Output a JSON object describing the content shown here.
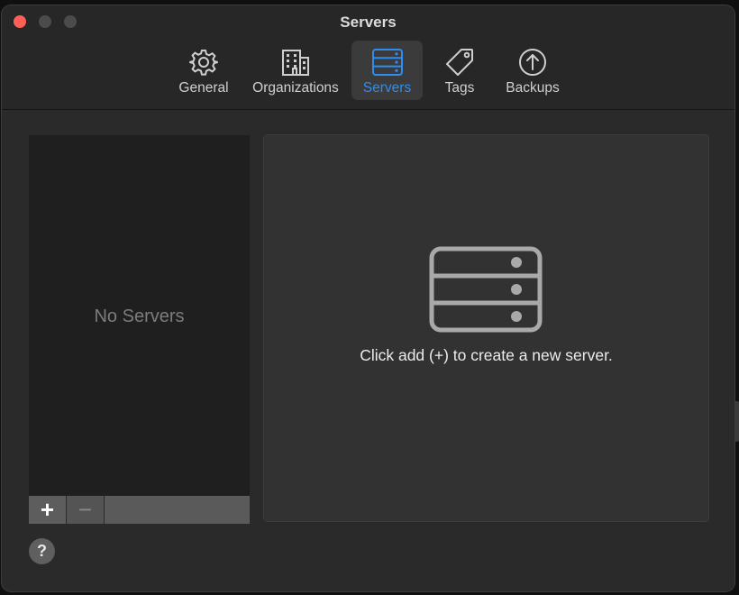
{
  "window": {
    "title": "Servers"
  },
  "toolbar": {
    "items": [
      {
        "label": "General",
        "icon": "gear-icon",
        "selected": false
      },
      {
        "label": "Organizations",
        "icon": "building-icon",
        "selected": false
      },
      {
        "label": "Servers",
        "icon": "server-icon",
        "selected": true
      },
      {
        "label": "Tags",
        "icon": "tag-icon",
        "selected": false
      },
      {
        "label": "Backups",
        "icon": "upload-circle-icon",
        "selected": false
      }
    ]
  },
  "server_list": {
    "empty_text": "No Servers",
    "add_label": "+",
    "remove_label": "−"
  },
  "detail": {
    "icon": "server-icon",
    "message": "Click add (+) to create a new server."
  },
  "help": {
    "label": "?"
  },
  "colors": {
    "accent": "#2f8cf0",
    "close": "#fe5f57",
    "window_bg": "#2a2a2a"
  }
}
